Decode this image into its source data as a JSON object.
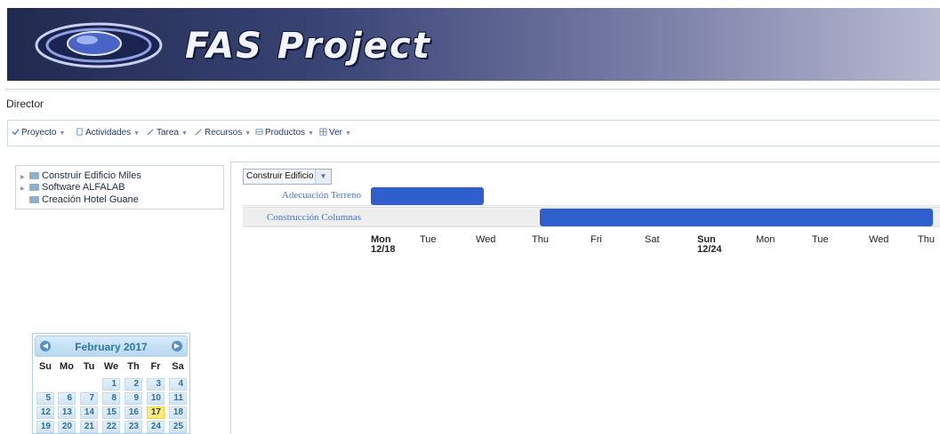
{
  "banner": {
    "title": "FAS Project",
    "logo_icon": "globe-logo-icon"
  },
  "role": "Director",
  "menu": [
    {
      "label": "Proyecto",
      "icon": "check-icon"
    },
    {
      "label": "Actividades",
      "icon": "document-icon"
    },
    {
      "label": "Tarea",
      "icon": "pencil-icon"
    },
    {
      "label": "Recursos",
      "icon": "pencil-icon"
    },
    {
      "label": "Productos",
      "icon": "box-icon"
    },
    {
      "label": "Ver",
      "icon": "grid-icon"
    }
  ],
  "tree": [
    {
      "label": "Construir Edificio Miles",
      "expandable": true
    },
    {
      "label": "Software ALFALAB",
      "expandable": true
    },
    {
      "label": "Creación Hotel Guane",
      "expandable": false
    }
  ],
  "gantt": {
    "project_select": "Construir Edificio M",
    "tasks": [
      {
        "name": "Adecuación Terreno"
      },
      {
        "name": "Construcción Columnas"
      }
    ],
    "days": [
      {
        "name": "Mon",
        "date": "12/18",
        "bold": true
      },
      {
        "name": "Tue",
        "date": "",
        "bold": false
      },
      {
        "name": "Wed",
        "date": "",
        "bold": false
      },
      {
        "name": "Thu",
        "date": "",
        "bold": false
      },
      {
        "name": "Fri",
        "date": "",
        "bold": false
      },
      {
        "name": "Sat",
        "date": "",
        "bold": false
      },
      {
        "name": "Sun",
        "date": "12/24",
        "bold": true
      },
      {
        "name": "Mon",
        "date": "",
        "bold": false
      },
      {
        "name": "Tue",
        "date": "",
        "bold": false
      },
      {
        "name": "Wed",
        "date": "",
        "bold": false
      },
      {
        "name": "Thu",
        "date": "",
        "bold": false
      }
    ],
    "bar_color": "#2f5fcc"
  },
  "calendar": {
    "title": "February 2017",
    "prev_icon": "circle-arrow-left-icon",
    "next_icon": "circle-arrow-right-icon",
    "weekdays": [
      "Su",
      "Mo",
      "Tu",
      "We",
      "Th",
      "Fr",
      "Sa"
    ],
    "weeks": [
      [
        "",
        "",
        "",
        "1",
        "2",
        "3",
        "4"
      ],
      [
        "5",
        "6",
        "7",
        "8",
        "9",
        "10",
        "11"
      ],
      [
        "12",
        "13",
        "14",
        "15",
        "16",
        "17",
        "18"
      ],
      [
        "19",
        "20",
        "21",
        "22",
        "23",
        "24",
        "25"
      ]
    ],
    "today": "17"
  }
}
